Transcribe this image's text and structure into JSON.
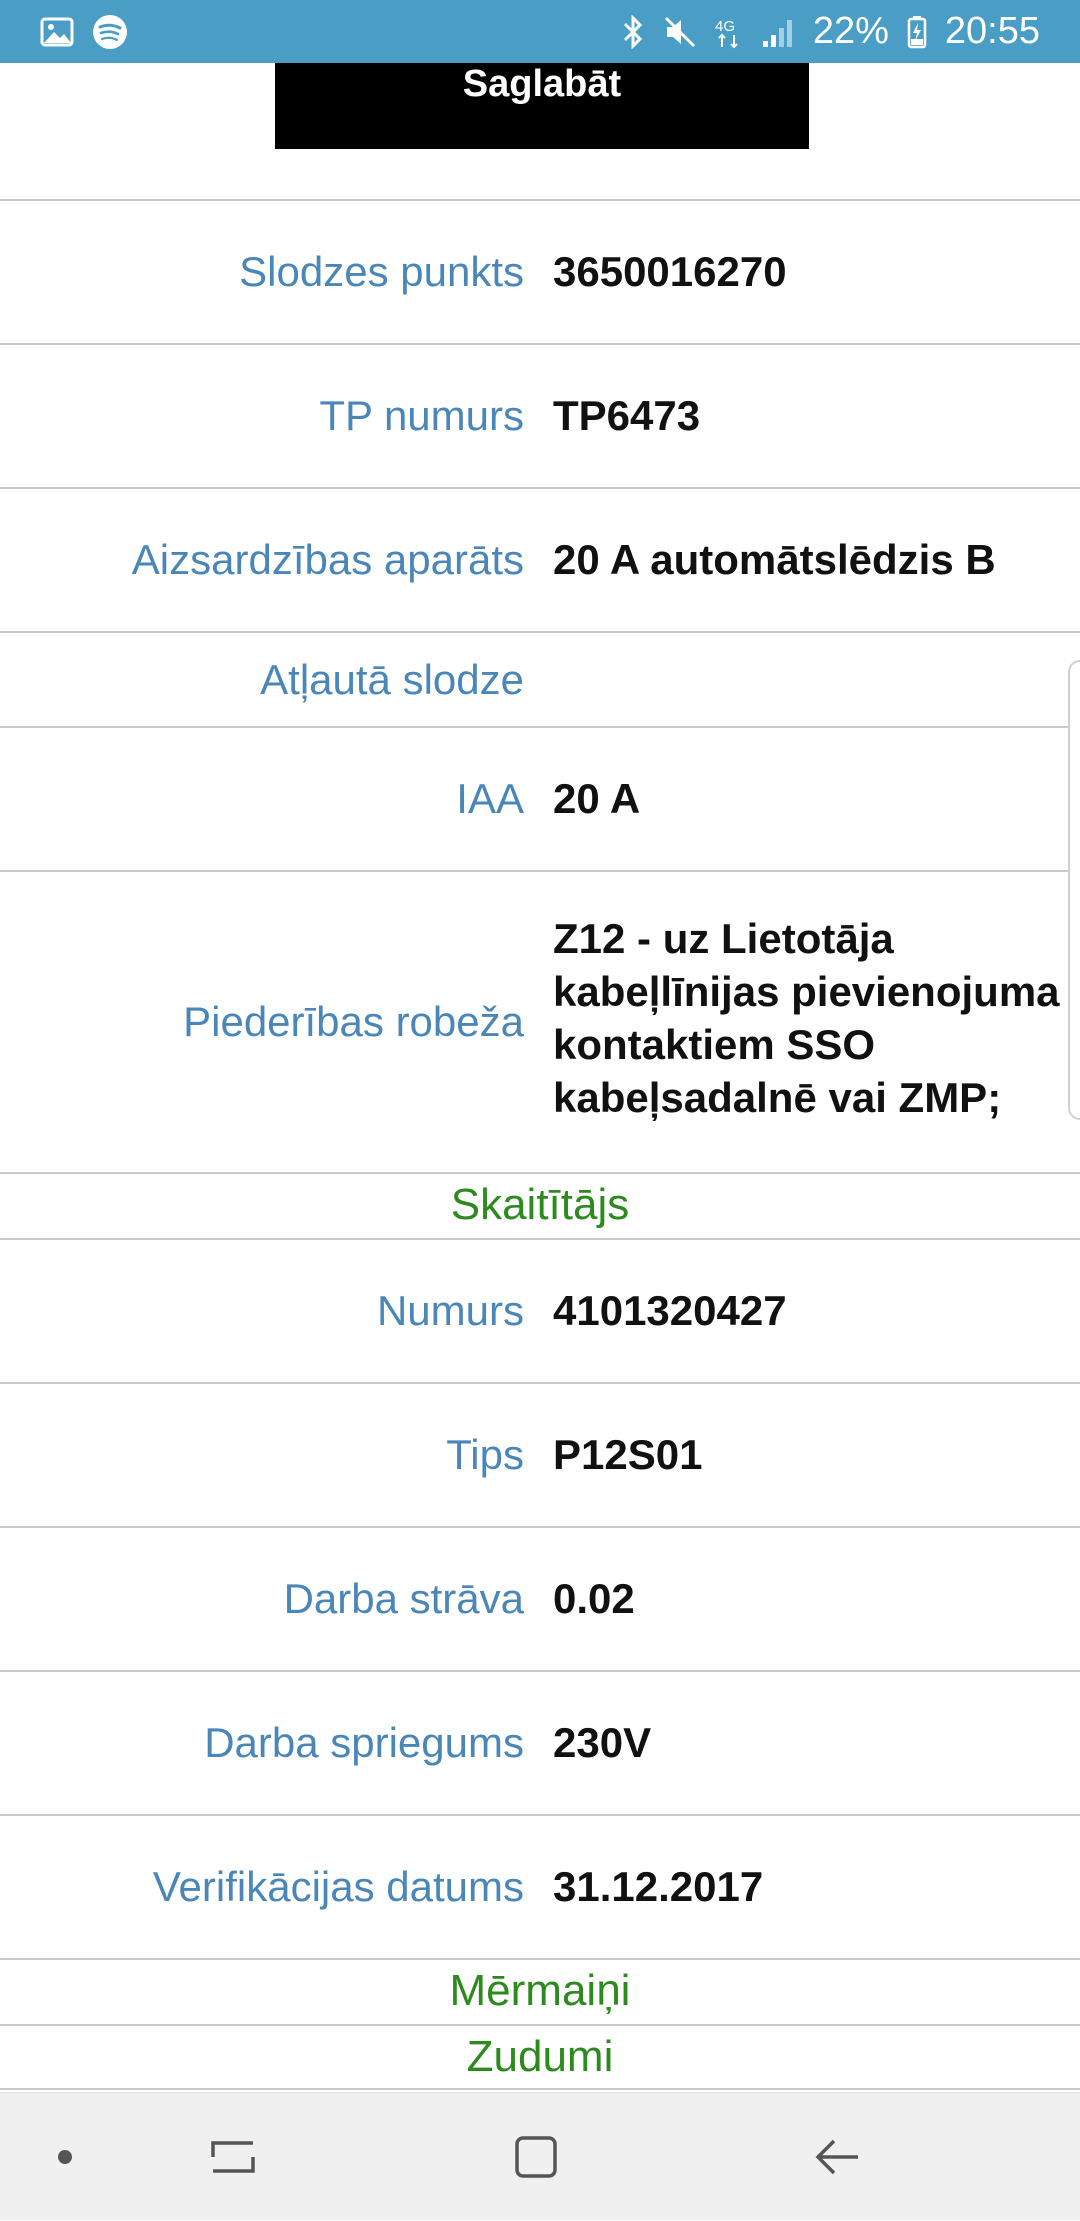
{
  "status_bar": {
    "left_icons": [
      "gallery-icon",
      "spotify-icon"
    ],
    "right_icons": [
      "bluetooth-icon",
      "mute-icon",
      "network-4g-icon",
      "signal-icon",
      "battery-charging-icon"
    ],
    "battery_percent": "22%",
    "time": "20:55"
  },
  "toolbar": {
    "save_label": "Saglabāt"
  },
  "rows": [
    {
      "label": "Slodzes punkts",
      "value": "3650016270"
    },
    {
      "label": "TP numurs",
      "value": "TP6473"
    },
    {
      "label": "Aizsardzības aparāts",
      "value": "20 A automātslēdzis B"
    },
    {
      "label": "Atļautā slodze",
      "value": ""
    },
    {
      "label": "IAA",
      "value": "20 A"
    },
    {
      "label": "Piederības robeža",
      "value": "Z12 - uz Lietotāja kabeļlīnijas pievienojuma kontaktiem SSO kabeļsadalnē vai ZMP;"
    }
  ],
  "sections": {
    "meter": "Skaitītājs",
    "transformers": "Mērmaiņi",
    "losses": "Zudumi"
  },
  "meter_rows": [
    {
      "label": "Numurs",
      "value": "4101320427"
    },
    {
      "label": "Tips",
      "value": "P12S01"
    },
    {
      "label": "Darba strāva",
      "value": "0.02"
    },
    {
      "label": "Darba spriegums",
      "value": "230V"
    },
    {
      "label": "Verifikācijas datums",
      "value": "31.12.2017"
    }
  ],
  "nav_bar": {
    "items": [
      "dot-icon",
      "recent-apps-icon",
      "home-icon",
      "back-icon"
    ]
  },
  "colors": {
    "status_bar": "#4a9ec5",
    "label": "#4a86b8",
    "section": "#2d8a1e",
    "button": "#000000"
  }
}
